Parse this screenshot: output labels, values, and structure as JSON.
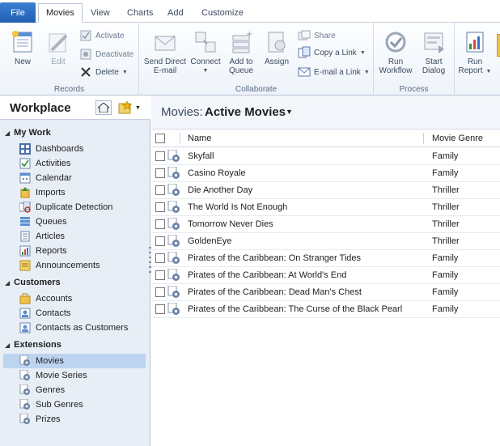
{
  "tabs": {
    "file": "File",
    "movies": "Movies",
    "view": "View",
    "charts": "Charts",
    "add": "Add",
    "customize": "Customize"
  },
  "ribbon": {
    "records": {
      "label": "Records",
      "new": "New",
      "edit": "Edit",
      "activate": "Activate",
      "deactivate": "Deactivate",
      "delete": "Delete"
    },
    "collaborate": {
      "label": "Collaborate",
      "send_direct_line1": "Send Direct",
      "send_direct_line2": "E-mail",
      "connect": "Connect",
      "add_to_queue_line1": "Add to",
      "add_to_queue_line2": "Queue",
      "assign": "Assign",
      "share": "Share",
      "copy_link": "Copy a Link",
      "email_link": "E-mail a Link"
    },
    "process": {
      "label": "Process",
      "run_workflow_line1": "Run",
      "run_workflow_line2": "Workflow",
      "start_dialog_line1": "Start",
      "start_dialog_line2": "Dialog"
    },
    "run_report_line1": "Run",
    "run_report_line2": "Report"
  },
  "nav": {
    "title": "Workplace",
    "sections": {
      "my_work": "My Work",
      "customers": "Customers",
      "extensions": "Extensions"
    },
    "my_work": [
      "Dashboards",
      "Activities",
      "Calendar",
      "Imports",
      "Duplicate Detection",
      "Queues",
      "Articles",
      "Reports",
      "Announcements"
    ],
    "customers": [
      "Accounts",
      "Contacts",
      "Contacts as Customers"
    ],
    "extensions": [
      "Movies",
      "Movie Series",
      "Genres",
      "Sub Genres",
      "Prizes"
    ]
  },
  "view": {
    "prefix": "Movies:",
    "name": "Active Movies"
  },
  "grid": {
    "columns": {
      "name": "Name",
      "genre": "Movie Genre"
    },
    "rows": [
      {
        "name": "Skyfall",
        "genre": "Family"
      },
      {
        "name": "Casino Royale",
        "genre": "Family"
      },
      {
        "name": "Die Another Day",
        "genre": "Thriller"
      },
      {
        "name": "The World Is Not Enough",
        "genre": "Thriller"
      },
      {
        "name": "Tomorrow Never Dies",
        "genre": "Thriller"
      },
      {
        "name": "GoldenEye",
        "genre": "Thriller"
      },
      {
        "name": "Pirates of the Caribbean: On Stranger Tides",
        "genre": "Family"
      },
      {
        "name": "Pirates of the Caribbean: At World's End",
        "genre": "Family"
      },
      {
        "name": "Pirates of the Caribbean: Dead Man's Chest",
        "genre": "Family"
      },
      {
        "name": "Pirates of the Caribbean: The Curse of the Black Pearl",
        "genre": "Family"
      }
    ]
  },
  "colors": {
    "file_tab": "#2b6cc4",
    "nav_bg": "#e8eef6",
    "nav_selected": "#bcd4ef",
    "ribbon_border": "#b7c4d6"
  }
}
